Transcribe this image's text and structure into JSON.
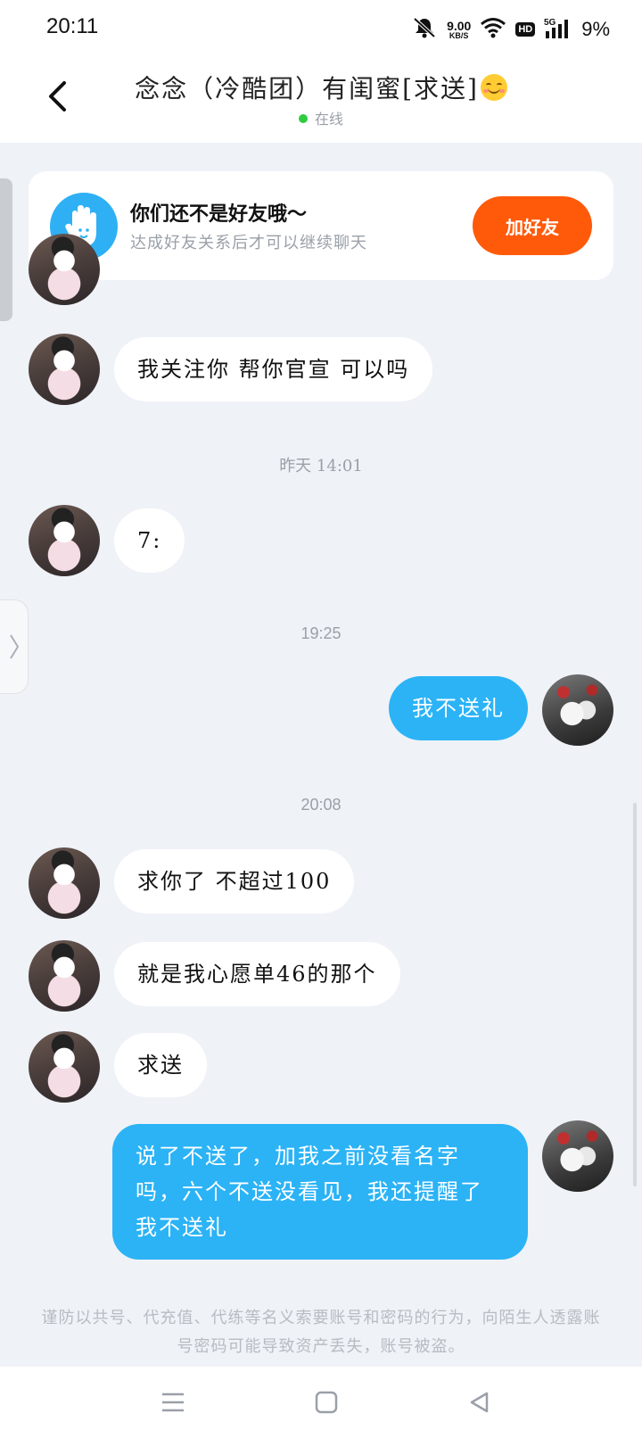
{
  "status_bar": {
    "time": "20:11",
    "net_speed_value": "9.00",
    "net_speed_unit": "KB/S",
    "hd": "HD",
    "network": "5G",
    "battery": "9%"
  },
  "header": {
    "title": "念念（冷酷团）有闺蜜[求送]",
    "status": "在线"
  },
  "friend_card": {
    "title": "你们还不是好友哦～",
    "subtitle": "达成好友关系后才可以继续聊天",
    "button": "加好友"
  },
  "messages": [
    {
      "side": "in",
      "text": "我关注你 帮你官宣 可以吗"
    },
    {
      "type": "time",
      "text": "昨天 14:01"
    },
    {
      "side": "in",
      "text": "7:"
    },
    {
      "type": "time",
      "text": "19:25"
    },
    {
      "side": "out",
      "text": "我不送礼"
    },
    {
      "type": "time",
      "text": "20:08"
    },
    {
      "side": "in",
      "text": "求你了 不超过100"
    },
    {
      "side": "in",
      "text": "就是我心愿单46的那个"
    },
    {
      "side": "in",
      "text": "求送"
    },
    {
      "side": "out",
      "text": "说了不送了，加我之前没看名字吗，六个不送没看见，我还提醒了我不送礼"
    }
  ],
  "notice": "谨防以共号、代充值、代练等名义索要账号和密码的行为，向陌生人透露账号密码可能导致资产丢失，账号被盗。",
  "colors": {
    "accent_blue": "#2bb3f6",
    "add_friend_orange": "#ff5a0a",
    "online_green": "#2ecc40",
    "background": "#eff2f7"
  }
}
